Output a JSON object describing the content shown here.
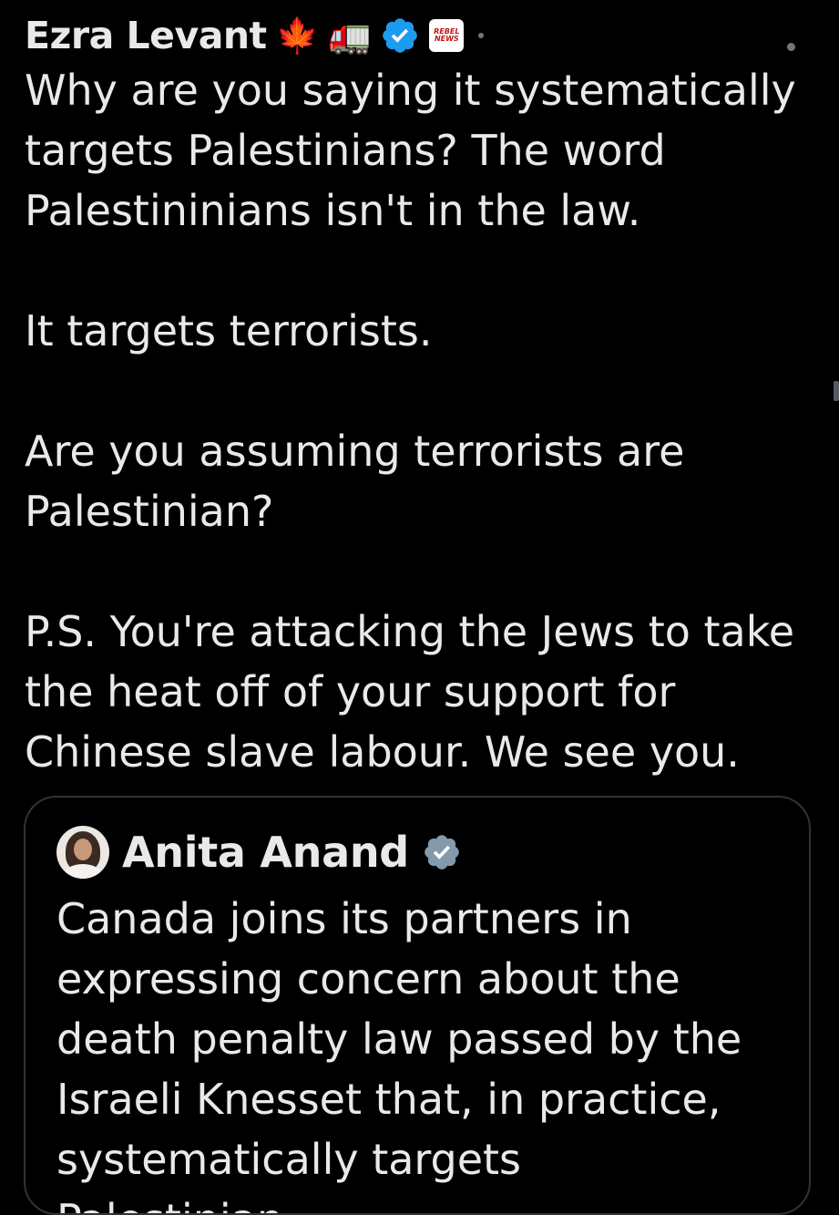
{
  "tweet": {
    "author_name": "Ezra Levant",
    "name_emojis": [
      "🍁",
      "🚛"
    ],
    "verified_icon": "verified-badge-icon",
    "affiliate_badge_text": [
      "REBEL",
      "NEWS"
    ],
    "paragraphs": [
      "Why are you saying it systematically targets Palestinians? The word Palestininians isn't in the law.",
      "It targets terrorists.",
      "Are you assuming terrorists are Palestinian?",
      "P.S. You're attacking the Jews to take the heat off of your support for Chinese slave labour. We see you."
    ]
  },
  "quoted_tweet": {
    "author_name": "Anita Anand",
    "verified_icon": "verified-gray-badge-icon",
    "text": "Canada joins its partners in expressing concern about the death penalty law passed by the Israeli Knesset that, in practice, systematically targets Palestinian..."
  },
  "colors": {
    "background": "#000000",
    "text": "#e7e9ea",
    "verified_blue": "#1d9bf0",
    "verified_gray": "#829aab",
    "border": "#2f3336",
    "muted": "#71767b"
  }
}
